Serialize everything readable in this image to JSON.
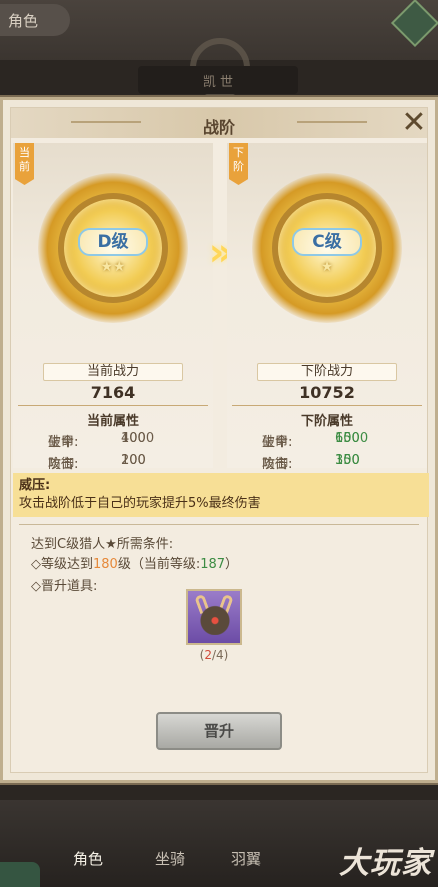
{
  "background": {
    "tab_title": "角色",
    "top_bar_text": "凯 世",
    "nav": [
      {
        "label": "角色"
      },
      {
        "label": "坐骑"
      },
      {
        "label": "羽翼"
      }
    ],
    "watermark": "大玩家"
  },
  "modal": {
    "title": "战阶",
    "current": {
      "tag": "当前",
      "rank": "D级",
      "stars": "★★",
      "power_label": "当前战力",
      "power_value": "7164",
      "attr_title": "当前属性",
      "attrs": [
        {
          "name": "生命:",
          "value": "4000"
        },
        {
          "name": "攻击:",
          "value": "200"
        },
        {
          "name": "破甲:",
          "value": "100"
        },
        {
          "name": "防御:",
          "value": "100"
        }
      ]
    },
    "next": {
      "tag": "下阶",
      "rank": "C级",
      "stars": "★",
      "power_label": "下阶战力",
      "power_value": "10752",
      "attr_title": "下阶属性",
      "attrs": [
        {
          "name": "生命:",
          "value": "6000"
        },
        {
          "name": "攻击:",
          "value": "300"
        },
        {
          "name": "破甲:",
          "value": "150"
        },
        {
          "name": "防御:",
          "value": "150"
        }
      ]
    },
    "buff": {
      "title": "威压:",
      "desc": "攻击战阶低于自己的玩家提升5%最终伤害"
    },
    "requirements": {
      "header": "达到C级猎人★所需条件:",
      "level_prefix": "◇等级达到",
      "level_required": "180",
      "level_mid": "级（当前等级:",
      "level_current": "187",
      "level_suffix": "）",
      "item_label": "◇晋升道具:",
      "item_count_owned": "2",
      "item_count_needed": "/4"
    },
    "upgrade_button": "晋升",
    "arrow_symbol": "»",
    "colors": {
      "buff_bg": "#f7df96",
      "tag_bg": "#e9a23b",
      "stat_up": "#3c8c43",
      "count_short": "#d24b3b"
    }
  }
}
